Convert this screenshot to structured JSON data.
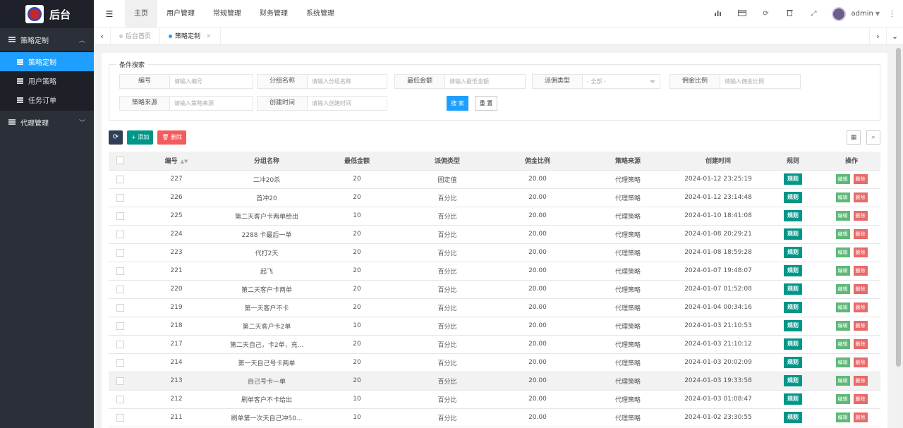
{
  "app": {
    "title": "后台"
  },
  "sidebar": {
    "groups": [
      {
        "label": "策略定制",
        "chev": "︿"
      },
      {
        "label": "代理管理",
        "chev": "﹀"
      }
    ],
    "sub_items": [
      "策略定制",
      "用户策略",
      "任务订单"
    ]
  },
  "header": {
    "menu_icon": "☰",
    "tabs": [
      "主页",
      "用户管理",
      "常规管理",
      "财务管理",
      "系统管理"
    ],
    "icons": [
      "chart-icon",
      "card-icon",
      "refresh-icon",
      "trash-icon",
      "fullscreen-icon"
    ],
    "user": "admin"
  },
  "tabstrip": {
    "tabs": [
      "后台首页",
      "策略定制"
    ]
  },
  "search": {
    "legend": "条件搜索",
    "fields": [
      {
        "label": "编号",
        "placeholder": "请输入编号"
      },
      {
        "label": "分组名称",
        "placeholder": "请输入分组名称"
      },
      {
        "label": "最低金额",
        "placeholder": "请输入最低金额"
      },
      {
        "label": "派佣类型",
        "placeholder": "- 全部 -"
      },
      {
        "label": "佣金比例",
        "placeholder": "请输入佣金比例"
      },
      {
        "label": "策略来源",
        "placeholder": "请输入策略来源"
      },
      {
        "label": "创建时间",
        "placeholder": "请输入创建时间"
      }
    ],
    "search_label": "搜 索",
    "reset_label": "重 置"
  },
  "toolbar": {
    "add_label": "+ 添加",
    "delete_label": "删除"
  },
  "table": {
    "headers": [
      "编号",
      "分组名称",
      "最低金额",
      "派佣类型",
      "佣金比例",
      "策略来源",
      "创建时间",
      "规则",
      "操作"
    ],
    "rule_label": "规则",
    "edit_label": "编辑",
    "del_label": "删除",
    "rows": [
      {
        "id": "227",
        "name": "二冲20杀",
        "min": "20",
        "type": "固定值",
        "ratio": "20.00",
        "source": "代理策略",
        "time": "2024-01-12 23:25:19"
      },
      {
        "id": "226",
        "name": "首冲20",
        "min": "20",
        "type": "百分比",
        "ratio": "20.00",
        "source": "代理策略",
        "time": "2024-01-12 23:14:48"
      },
      {
        "id": "225",
        "name": "第二天客户卡两单给出",
        "min": "10",
        "type": "百分比",
        "ratio": "20.00",
        "source": "代理策略",
        "time": "2024-01-10 18:41:08"
      },
      {
        "id": "224",
        "name": "2288 卡最后一单",
        "min": "20",
        "type": "百分比",
        "ratio": "20.00",
        "source": "代理策略",
        "time": "2024-01-08 20:29:21"
      },
      {
        "id": "223",
        "name": "代打2天",
        "min": "20",
        "type": "百分比",
        "ratio": "20.00",
        "source": "代理策略",
        "time": "2024-01-08 18:59:28"
      },
      {
        "id": "221",
        "name": "起飞",
        "min": "20",
        "type": "百分比",
        "ratio": "20.00",
        "source": "代理策略",
        "time": "2024-01-07 19:48:07"
      },
      {
        "id": "220",
        "name": "第二天客户卡两单",
        "min": "20",
        "type": "百分比",
        "ratio": "20.00",
        "source": "代理策略",
        "time": "2024-01-07 01:52:08"
      },
      {
        "id": "219",
        "name": "第一天客户不卡",
        "min": "20",
        "type": "百分比",
        "ratio": "20.00",
        "source": "代理策略",
        "time": "2024-01-04 00:34:16"
      },
      {
        "id": "218",
        "name": "第二天客户卡2单",
        "min": "10",
        "type": "百分比",
        "ratio": "20.00",
        "source": "代理策略",
        "time": "2024-01-03 21:10:53"
      },
      {
        "id": "217",
        "name": "第二天自己，卡2单，充...",
        "min": "20",
        "type": "百分比",
        "ratio": "20.00",
        "source": "代理策略",
        "time": "2024-01-03 21:10:12"
      },
      {
        "id": "214",
        "name": "第一天自己号卡两单",
        "min": "20",
        "type": "百分比",
        "ratio": "20.00",
        "source": "代理策略",
        "time": "2024-01-03 20:02:09"
      },
      {
        "id": "213",
        "name": "自己号卡一单",
        "min": "20",
        "type": "百分比",
        "ratio": "20.00",
        "source": "代理策略",
        "time": "2024-01-03 19:33:58"
      },
      {
        "id": "212",
        "name": "刷单客户不卡给出",
        "min": "10",
        "type": "百分比",
        "ratio": "20.00",
        "source": "代理策略",
        "time": "2024-01-03 01:08:47"
      },
      {
        "id": "211",
        "name": "刷单第一次天自己冲50...",
        "min": "10",
        "type": "百分比",
        "ratio": "20.00",
        "source": "代理策略",
        "time": "2024-01-02 23:30:55"
      }
    ]
  }
}
